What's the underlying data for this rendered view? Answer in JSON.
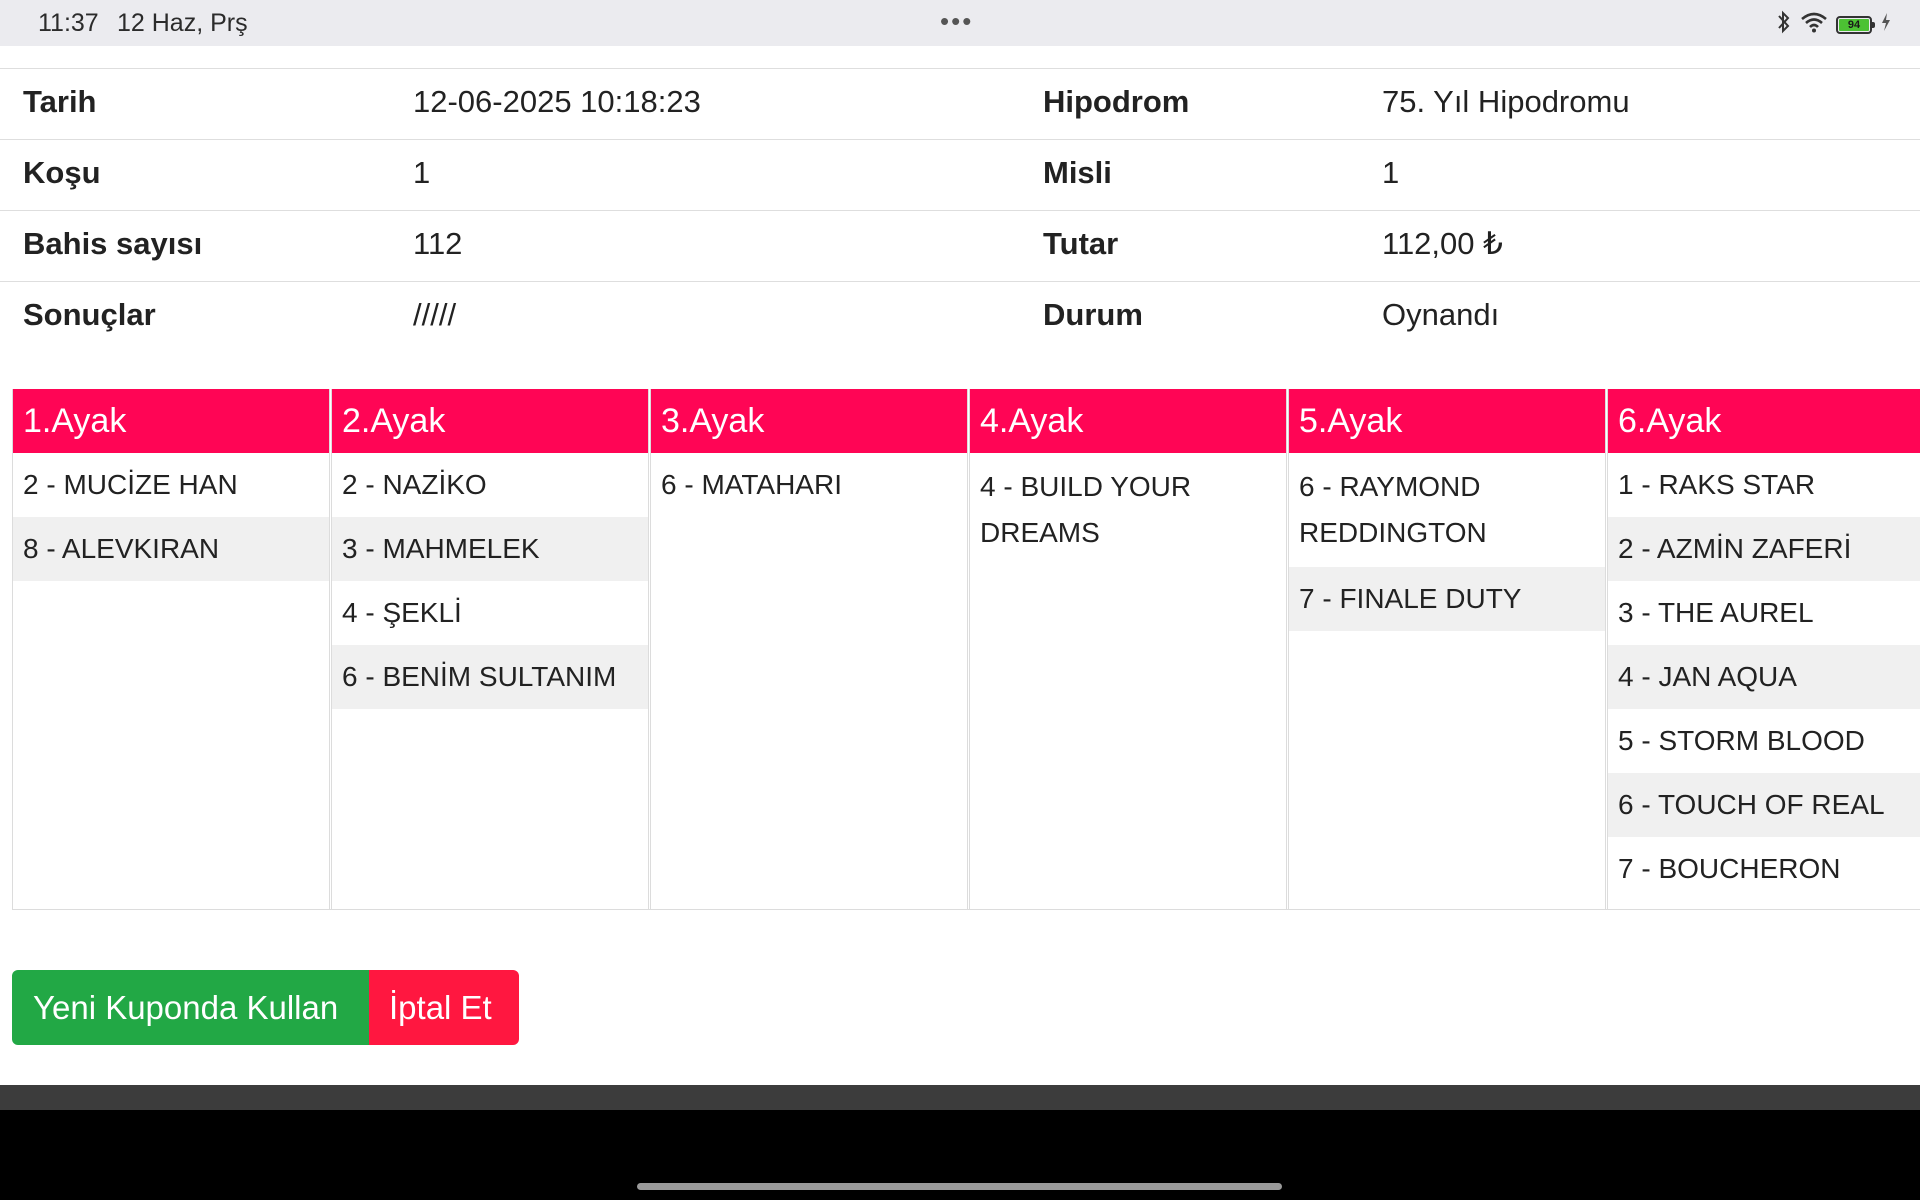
{
  "status_bar": {
    "time": "11:37",
    "date": "12 Haz, Prş",
    "dots": "•••",
    "battery": "94",
    "icons": [
      "bluetooth-icon",
      "wifi-icon",
      "battery-icon",
      "charging-icon"
    ]
  },
  "info": [
    {
      "label1": "Tarih",
      "value1": "12-06-2025 10:18:23",
      "label2": "Hipodrom",
      "value2": "75. Yıl Hipodromu"
    },
    {
      "label1": "Koşu",
      "value1": "1",
      "label2": "Misli",
      "value2": "1"
    },
    {
      "label1": "Bahis sayısı",
      "value1": "112",
      "label2": "Tutar",
      "value2": "112,00 ₺"
    },
    {
      "label1": "Sonuçlar",
      "value1": "/////",
      "label2": "Durum",
      "value2": "Oynandı"
    }
  ],
  "legs": [
    {
      "title": "1.Ayak",
      "horses": [
        "2 - MUCİZE HAN",
        "8 - ALEVKIRAN"
      ]
    },
    {
      "title": "2.Ayak",
      "horses": [
        "2 - NAZİKO",
        "3 - MAHMELEK",
        "4 - ŞEKLİ",
        "6 - BENİM SULTANIM"
      ]
    },
    {
      "title": "3.Ayak",
      "horses": [
        "6 - MATAHARI"
      ]
    },
    {
      "title": "4.Ayak",
      "horses": [
        "4 - BUILD YOUR DREAMS"
      ]
    },
    {
      "title": "5.Ayak",
      "horses": [
        "6 - RAYMOND REDDINGTON",
        "7 - FINALE DUTY"
      ]
    },
    {
      "title": "6.Ayak",
      "horses": [
        "1 - RAKS STAR",
        "2 - AZMİN ZAFERİ",
        "3 - THE AUREL",
        "4 - JAN AQUA",
        "5 - STORM BLOOD",
        "6 - TOUCH OF REAL",
        "7 - BOUCHERON"
      ]
    }
  ],
  "buttons": {
    "reuse": "Yeni Kuponda Kullan",
    "cancel": "İptal Et"
  },
  "colors": {
    "leg_header": "#ff0555",
    "reuse_button": "#22a845",
    "cancel_button": "#ff1740"
  }
}
